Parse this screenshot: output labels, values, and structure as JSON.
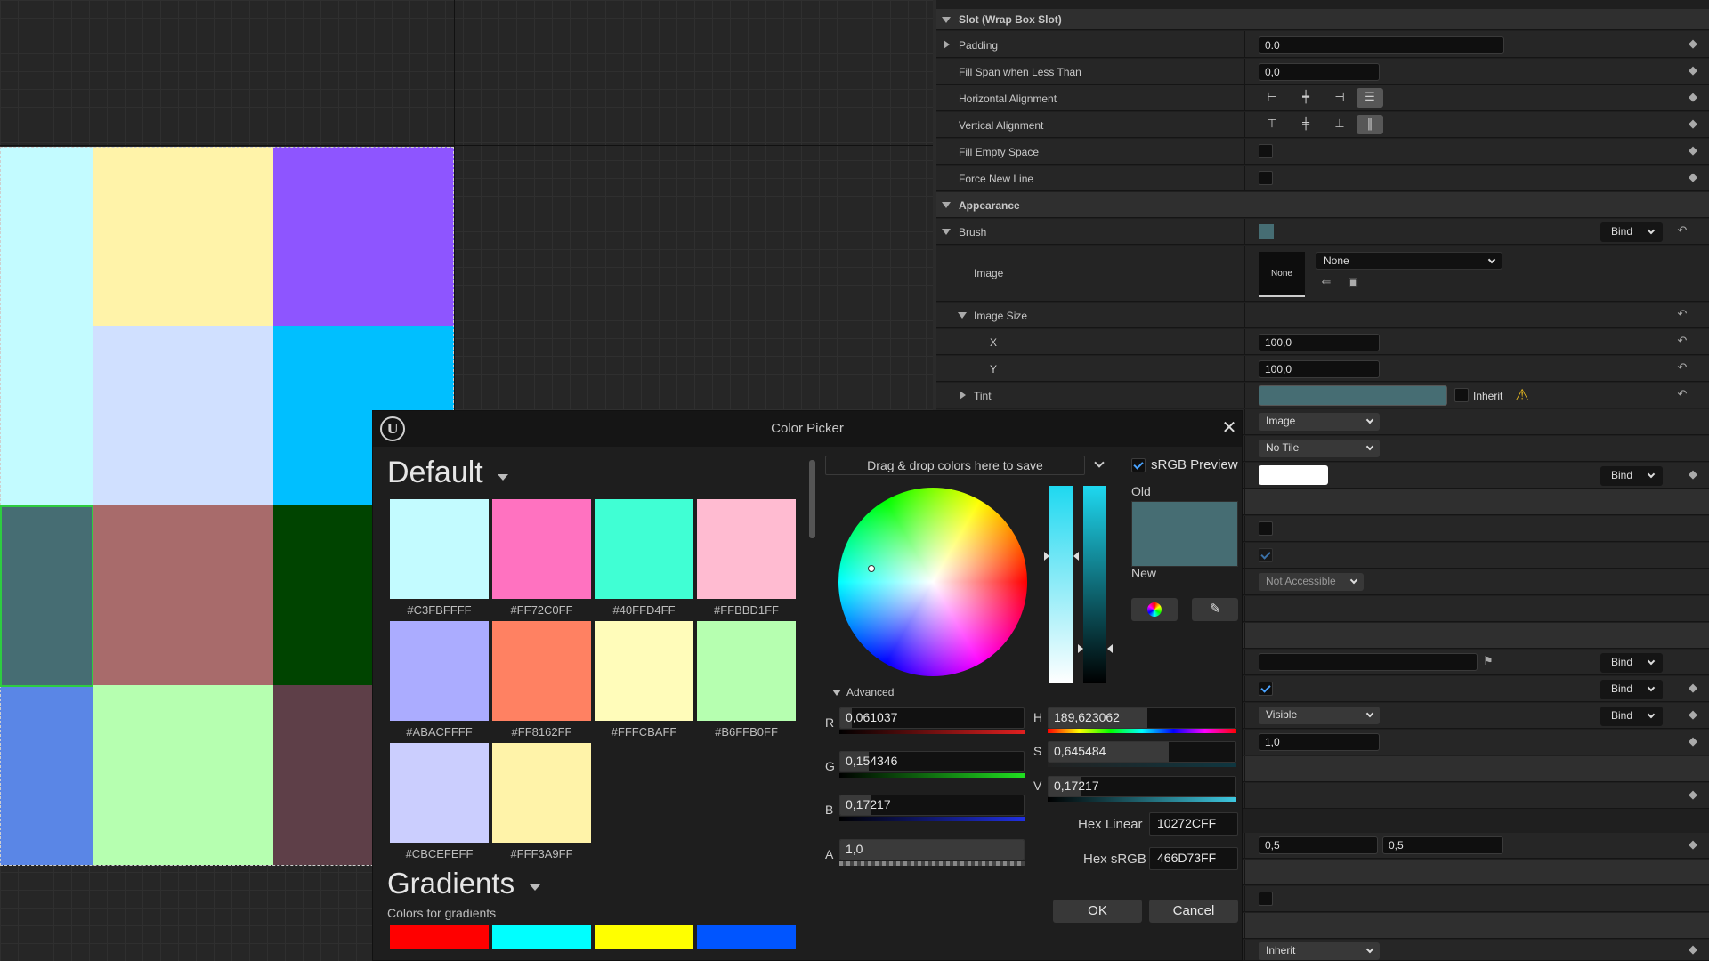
{
  "viewport": {
    "cells": [
      {
        "color": "#C3FBFF"
      },
      {
        "color": "#FFF3A9"
      },
      {
        "color": "#8E55FF"
      },
      {
        "color": "#C3FBFF"
      },
      {
        "color": "#D0E0FF"
      },
      {
        "color": "#00BFFF"
      },
      {
        "color": "#466D73"
      },
      {
        "color": "#A86B6B"
      },
      {
        "color": "#004400"
      },
      {
        "color": "#5A86E6"
      },
      {
        "color": "#B6FFB0"
      },
      {
        "color": "#5E3F48"
      }
    ]
  },
  "details": {
    "slot_section": "Slot (Wrap Box Slot)",
    "padding_label": "Padding",
    "padding_value": "0.0",
    "fill_span_label": "Fill Span when Less Than",
    "fill_span_value": "0,0",
    "h_align_label": "Horizontal Alignment",
    "v_align_label": "Vertical Alignment",
    "fill_empty_label": "Fill Empty Space",
    "force_new_line_label": "Force New Line",
    "appearance_section": "Appearance",
    "brush_label": "Brush",
    "brush_color": "#466D73",
    "bind_label": "Bind",
    "image_label": "Image",
    "image_thumb_text": "None",
    "image_dropdown": "None",
    "image_size_label": "Image Size",
    "x_label": "X",
    "x_value": "100,0",
    "y_label": "Y",
    "y_value": "100,0",
    "tint_label": "Tint",
    "tint_color": "#466D73",
    "inherit_label": "Inherit",
    "draw_as_value": "Image",
    "tiling_value": "No Tile",
    "accessible_value": "Not Accessible",
    "visibility_value": "Visible",
    "opacity_value": "1,0",
    "pivot_x": "0,5",
    "pivot_y": "0,5",
    "clipping_value": "Inherit"
  },
  "picker": {
    "title": "Color Picker",
    "default_title": "Default",
    "swatches": [
      {
        "color": "#C3FBFF",
        "label": "#C3FBFFFF"
      },
      {
        "color": "#FF72C0",
        "label": "#FF72C0FF"
      },
      {
        "color": "#40FFD4",
        "label": "#40FFD4FF"
      },
      {
        "color": "#FFBBD1",
        "label": "#FFBBD1FF"
      },
      {
        "color": "#ABACFF",
        "label": "#ABACFFFF"
      },
      {
        "color": "#FF8162",
        "label": "#FF8162FF"
      },
      {
        "color": "#FFFCBA",
        "label": "#FFFCBAFF"
      },
      {
        "color": "#B6FFB0",
        "label": "#B6FFB0FF"
      },
      {
        "color": "#CBCEFE",
        "label": "#CBCEFEFF"
      },
      {
        "color": "#FFF3A9",
        "label": "#FFF3A9FF"
      }
    ],
    "gradients_title": "Gradients",
    "gradients_subtitle": "Colors for gradients",
    "gradient_colors": [
      "#FF0000",
      "#00FFFF",
      "#FFFF00",
      "#0055FF"
    ],
    "drop_text": "Drag & drop colors here to save",
    "srgb_label": "sRGB Preview",
    "old_label": "Old",
    "new_label": "New",
    "old_color": "#466D73",
    "new_color": "#466D73",
    "advanced_label": "Advanced",
    "r_label": "R",
    "r_value": "0,061037",
    "r_level": 0.061,
    "g_label": "G",
    "g_value": "0,154346",
    "g_level": 0.154,
    "b_label": "B",
    "b_value": "0,17217",
    "b_level": 0.172,
    "a_label": "A",
    "a_value": "1,0",
    "a_level": 1.0,
    "h_label": "H",
    "h_value": "189,623062",
    "h_level": 0.527,
    "s_label": "S",
    "s_value": "0,645484",
    "s_level": 0.645,
    "v_label": "V",
    "v_value": "0,17217",
    "v_level": 0.172,
    "hex_linear_label": "Hex Linear",
    "hex_linear_value": "10272CFF",
    "hex_srgb_label": "Hex sRGB",
    "hex_srgb_value": "466D73FF",
    "ok_label": "OK",
    "cancel_label": "Cancel"
  }
}
